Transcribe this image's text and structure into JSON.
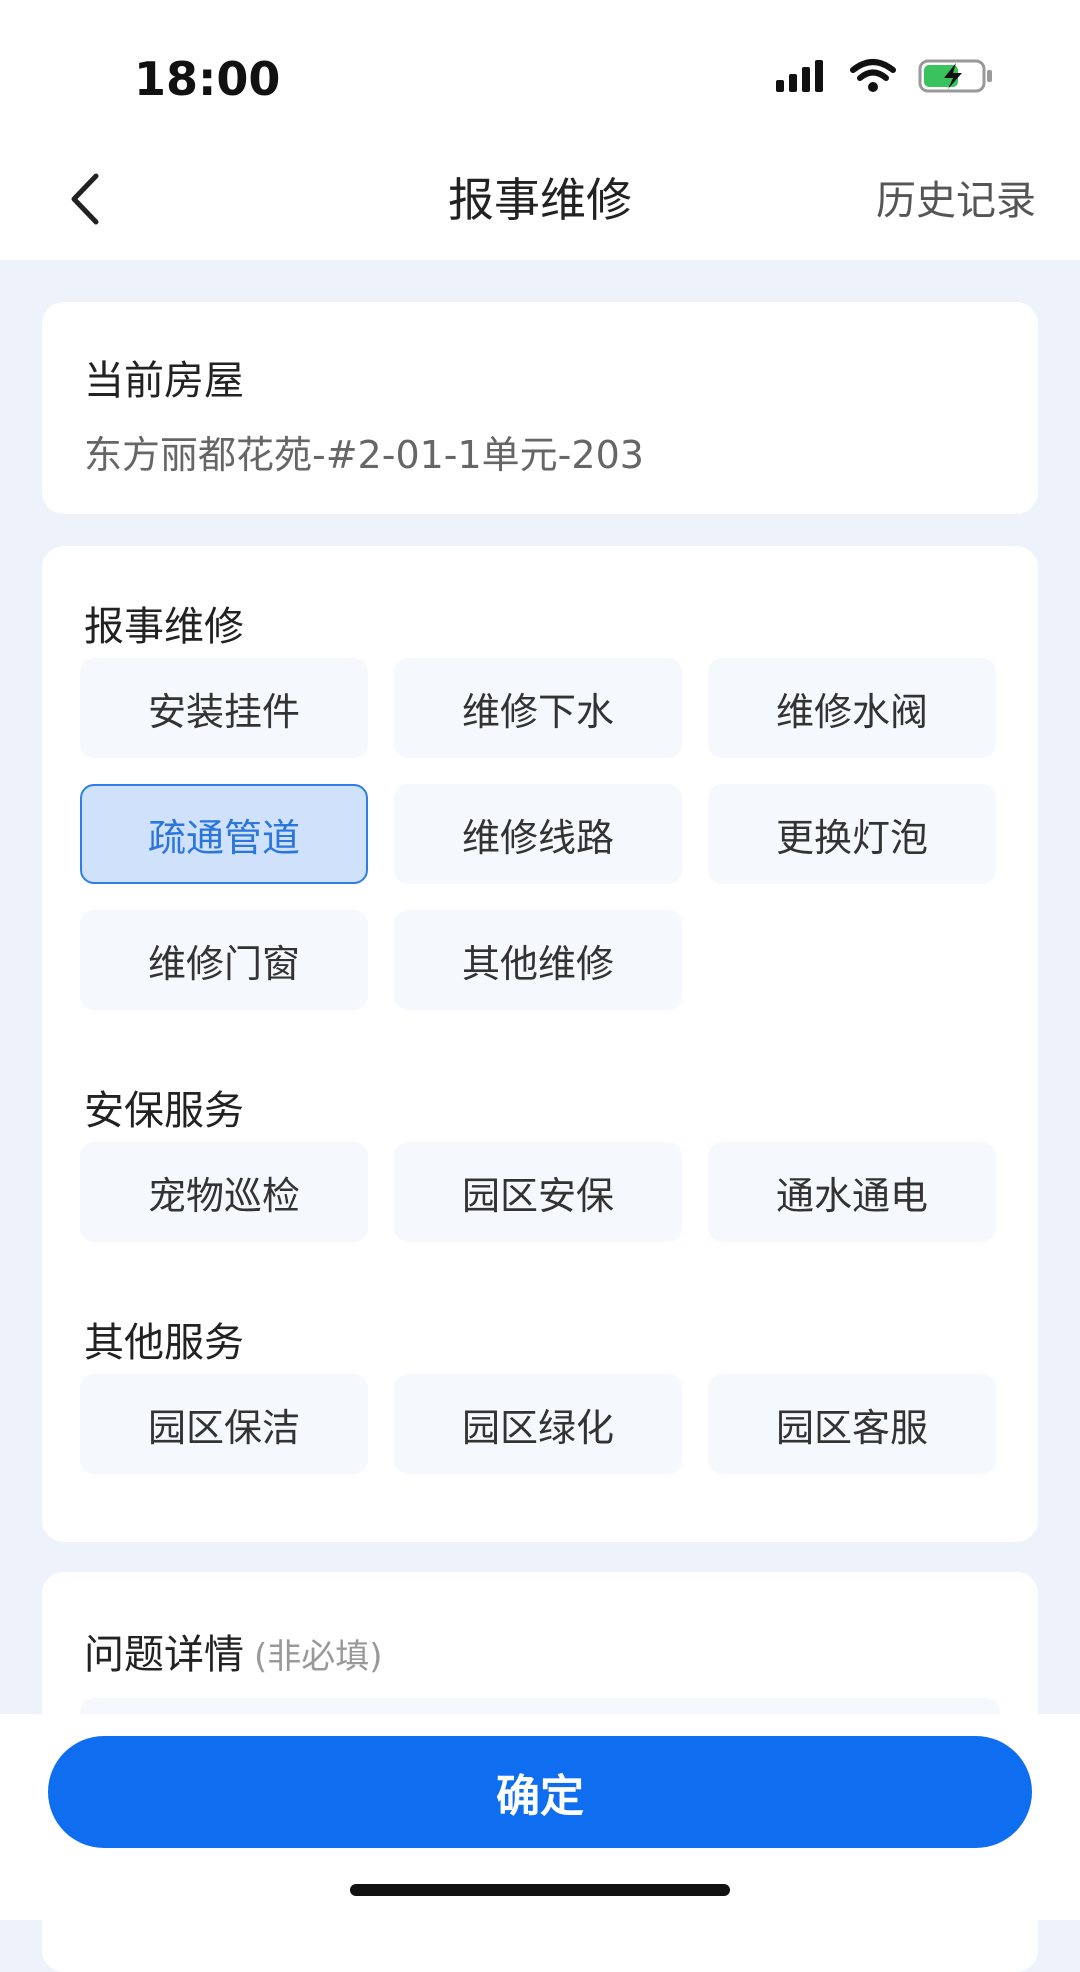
{
  "status_bar": {
    "time": "18:00",
    "icons": [
      "signal-icon",
      "wifi-icon",
      "battery-charging-icon"
    ]
  },
  "nav": {
    "title": "报事维修",
    "history_label": "历史记录"
  },
  "house": {
    "label": "当前房屋",
    "value": "东方丽都花苑-#2-01-1单元-203"
  },
  "groups": [
    {
      "title": "报事维修",
      "items": [
        "安装挂件",
        "维修下水",
        "维修水阀",
        "疏通管道",
        "维修线路",
        "更换灯泡",
        "维修门窗",
        "其他维修"
      ]
    },
    {
      "title": "安保服务",
      "items": [
        "宠物巡检",
        "园区安保",
        "通水通电"
      ]
    },
    {
      "title": "其他服务",
      "items": [
        "园区保洁",
        "园区绿化",
        "园区客服"
      ]
    }
  ],
  "selected_item": "疏通管道",
  "detail": {
    "title": "问题详情",
    "optional": "(非必填)"
  },
  "confirm_label": "确定",
  "colors": {
    "accent": "#0f6ef0",
    "selected_bg": "#cfe1fb",
    "selected_border": "#2f7ee8",
    "page_bg": "#eef3fb"
  }
}
